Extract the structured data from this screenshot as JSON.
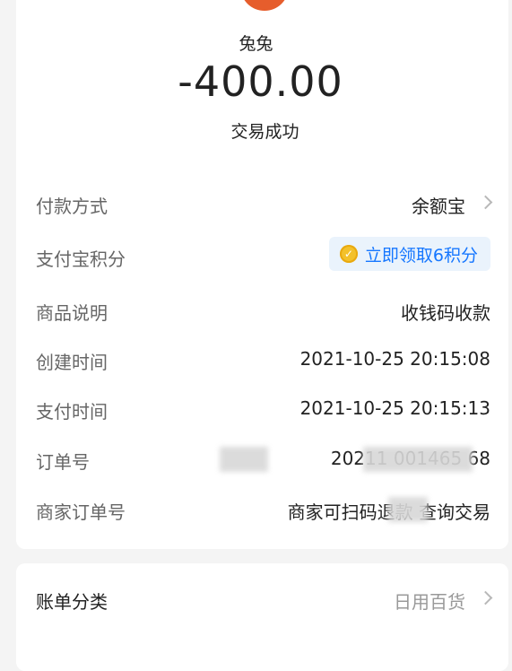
{
  "payee": {
    "name": "兔兔"
  },
  "amount": "-400.00",
  "status": "交易成功",
  "details": {
    "payment_method": {
      "label": "付款方式",
      "value": "余额宝"
    },
    "points": {
      "label": "支付宝积分",
      "button": "立即领取6积分",
      "coin_glyph": "✓"
    },
    "description": {
      "label": "商品说明",
      "value": "收钱码收款"
    },
    "created": {
      "label": "创建时间",
      "value": "2021-10-25 20:15:08"
    },
    "paid": {
      "label": "支付时间",
      "value": "2021-10-25 20:15:13"
    },
    "order_no": {
      "label": "订单号",
      "value": "20211 001465 68"
    },
    "merchant_order": {
      "label": "商家订单号",
      "value": "商家可扫码退款 查询交易"
    }
  },
  "bill": {
    "label": "账单分类",
    "value": "日用百货"
  },
  "colors": {
    "avatar": "#e65d2c",
    "accent": "#1677ff",
    "coin": "#f3c12b"
  },
  "icons": {
    "payment_chevron": "chevron-right-icon",
    "bill_chevron": "chevron-right-icon",
    "coin": "coin-icon"
  }
}
